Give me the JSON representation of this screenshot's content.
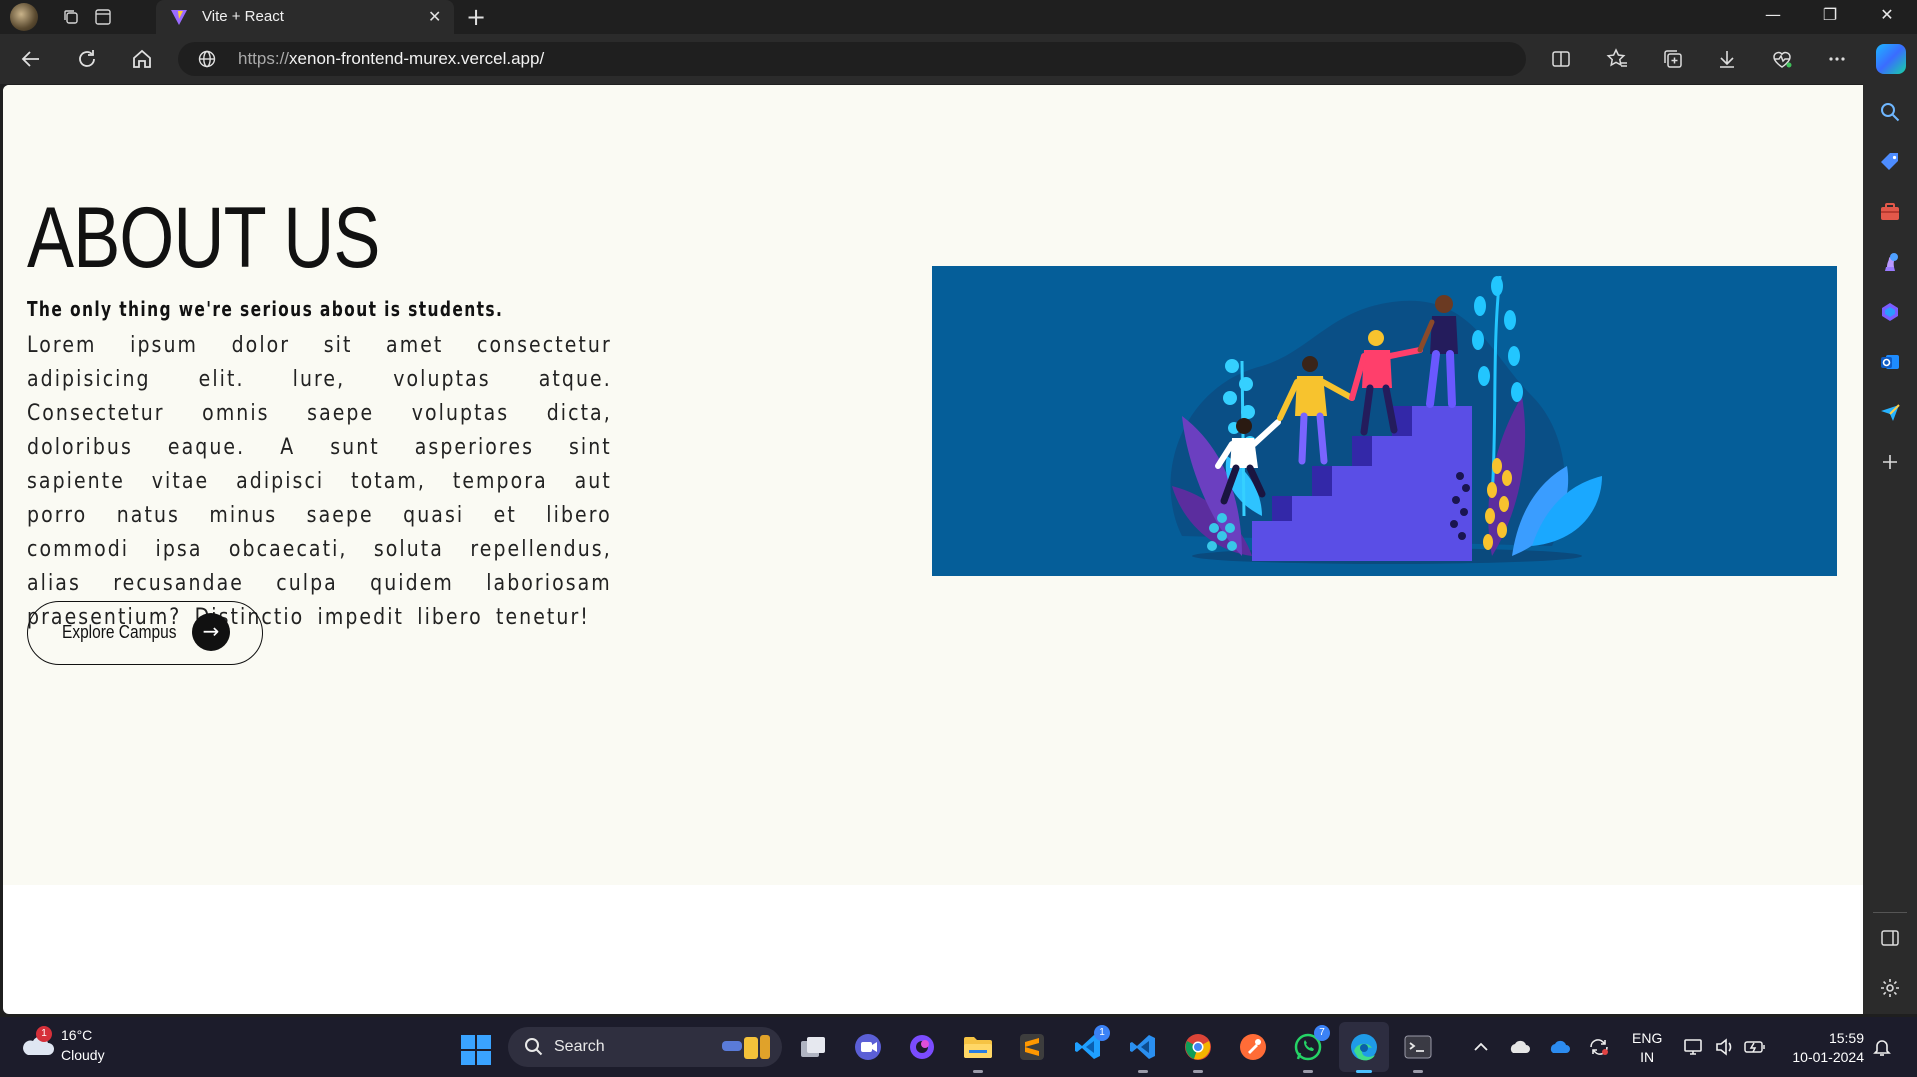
{
  "browser": {
    "tab_title": "Vite + React",
    "url_protocol": "https://",
    "url_host": "xenon-frontend-murex.vercel.app/"
  },
  "page": {
    "heading": "ABOUT US",
    "subheading": "The only thing we're serious about is students.",
    "body": "Lorem ipsum dolor sit amet consectetur adipisicing elit. lure, voluptas atque. Consectetur omnis saepe voluptas dicta, doloribus eaque. A sunt asperiores sint sapiente vitae adipisci totam, tempora aut porro natus minus saepe quasi et libero commodi ipsa obcaecati, soluta repellendus, alias recusandae culpa quidem laboriosam praesentium? Distinctio impedit libero tenetur!",
    "cta_label": "Explore Campus",
    "cta_arrow": "→",
    "image_bg": "#055e99"
  },
  "taskbar": {
    "weather_temp": "16°C",
    "weather_desc": "Cloudy",
    "weather_badge": "1",
    "search_label": "Search",
    "vscode_extra_badge": "1",
    "whatsapp_badge": "7",
    "lang_line1": "ENG",
    "lang_line2": "IN",
    "time": "15:59",
    "date": "10-01-2024"
  },
  "colors": {
    "accent": "#4cc2ff",
    "page_bg": "#fafaf3",
    "chrome_bg": "#2b2b2b"
  }
}
